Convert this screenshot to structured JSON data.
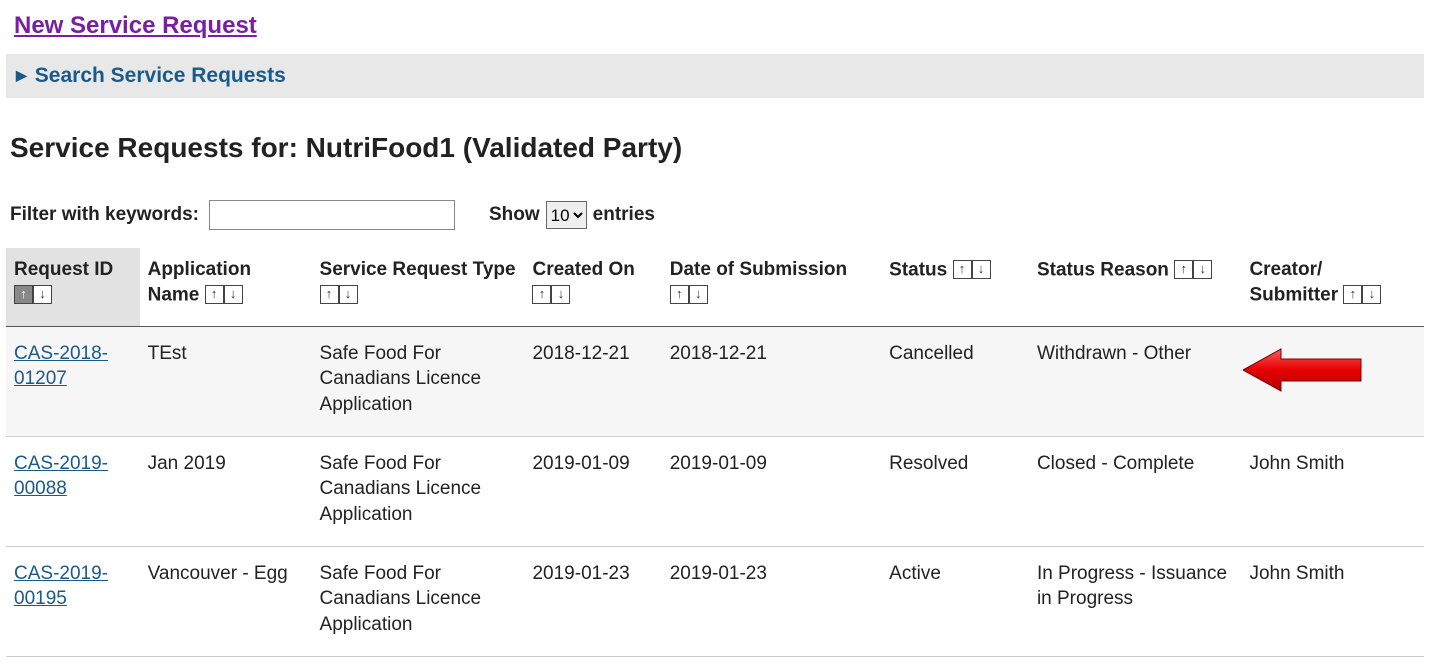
{
  "links": {
    "new_request": "New Service Request",
    "search_toggle": "Search Service Requests"
  },
  "page_title": "Service Requests for: NutriFood1 (Validated Party)",
  "filter": {
    "label": "Filter with keywords:",
    "value": "",
    "show_label_pre": "Show",
    "show_label_post": "entries",
    "show_value": "10"
  },
  "columns": {
    "id": "Request ID",
    "app": "Application Name",
    "type": "Service Request Type",
    "created": "Created On",
    "submitted": "Date of Submission",
    "status": "Status",
    "reason": "Status Reason",
    "creator": "Creator/ Submitter"
  },
  "rows": [
    {
      "id": "CAS-2018-01207",
      "app": "TEst",
      "type": "Safe Food For Canadians Licence Application",
      "created": "2018-12-21",
      "submitted": "2018-12-21",
      "status": "Cancelled",
      "reason": "Withdrawn - Other",
      "creator": "",
      "highlight": true,
      "arrow": true
    },
    {
      "id": "CAS-2019-00088",
      "app": "Jan 2019",
      "type": "Safe Food For Canadians Licence Application",
      "created": "2019-01-09",
      "submitted": "2019-01-09",
      "status": "Resolved",
      "reason": "Closed - Complete",
      "creator": "John Smith",
      "highlight": false,
      "arrow": false
    },
    {
      "id": "CAS-2019-00195",
      "app": "Vancouver - Egg",
      "type": "Safe Food For Canadians Licence Application",
      "created": "2019-01-23",
      "submitted": "2019-01-23",
      "status": "Active",
      "reason": "In Progress - Issuance in Progress",
      "creator": "John Smith",
      "highlight": false,
      "arrow": false
    }
  ]
}
